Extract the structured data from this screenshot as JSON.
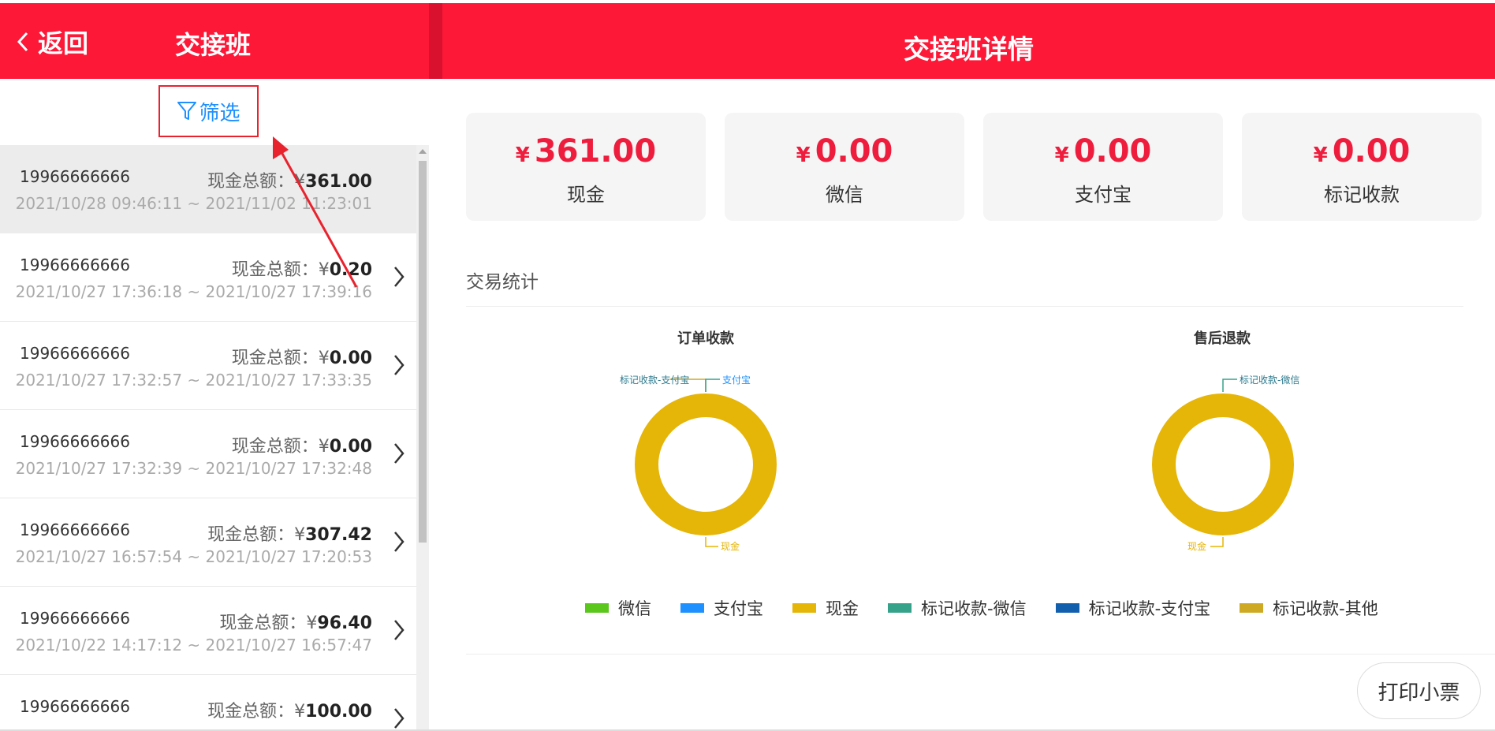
{
  "header": {
    "back_label": "返回",
    "left_title": "交接班",
    "right_title": "交接班详情"
  },
  "filter": {
    "label": "筛选"
  },
  "shift_list": {
    "amount_prefix": "现金总额：¥",
    "rows": [
      {
        "phone": "19966666666",
        "amount": "361.00",
        "time": "2021/10/28 09:46:11 ~ 2021/11/02 11:23:01"
      },
      {
        "phone": "19966666666",
        "amount": "0.20",
        "time": "2021/10/27 17:36:18 ~ 2021/10/27 17:39:16"
      },
      {
        "phone": "19966666666",
        "amount": "0.00",
        "time": "2021/10/27 17:32:57 ~ 2021/10/27 17:33:35"
      },
      {
        "phone": "19966666666",
        "amount": "0.00",
        "time": "2021/10/27 17:32:39 ~ 2021/10/27 17:32:48"
      },
      {
        "phone": "19966666666",
        "amount": "307.42",
        "time": "2021/10/27 16:57:54 ~ 2021/10/27 17:20:53"
      },
      {
        "phone": "19966666666",
        "amount": "96.40",
        "time": "2021/10/22 14:17:12 ~ 2021/10/27 16:57:47"
      },
      {
        "phone": "19966666666",
        "amount": "100.00",
        "time": ""
      }
    ]
  },
  "summary_cards": [
    {
      "currency": "¥",
      "value": "361.00",
      "label": "现金"
    },
    {
      "currency": "¥",
      "value": "0.00",
      "label": "微信"
    },
    {
      "currency": "¥",
      "value": "0.00",
      "label": "支付宝"
    },
    {
      "currency": "¥",
      "value": "0.00",
      "label": "标记收款"
    }
  ],
  "stats": {
    "section_title": "交易统计"
  },
  "colors": {
    "header_red": "#fd1838",
    "amount_red": "#ee1d3d",
    "wechat": "#5bc61c",
    "alipay": "#1e90ff",
    "cash": "#e5b507",
    "mark_wechat": "#36a28a",
    "mark_alipay": "#115fad",
    "mark_other": "#cea923"
  },
  "chart_data": [
    {
      "type": "pie",
      "title": "订单收款",
      "categories": [
        "微信",
        "支付宝",
        "现金",
        "标记收款-微信",
        "标记收款-支付宝",
        "标记收款-其他"
      ],
      "values": [
        0,
        0,
        361.0,
        0,
        0,
        0
      ],
      "labels_shown": {
        "top_left": "标记收款-支付宝",
        "top_right": "支付宝",
        "bottom": "现金"
      }
    },
    {
      "type": "pie",
      "title": "售后退款",
      "categories": [
        "微信",
        "支付宝",
        "现金",
        "标记收款-微信",
        "标记收款-支付宝",
        "标记收款-其他"
      ],
      "values": [
        0,
        0,
        1,
        0,
        0,
        0
      ],
      "labels_shown": {
        "top_right": "标记收款-微信",
        "bottom": "现金"
      }
    }
  ],
  "legend": [
    {
      "label": "微信",
      "color": "#5bc61c"
    },
    {
      "label": "支付宝",
      "color": "#1e90ff"
    },
    {
      "label": "现金",
      "color": "#e5b507"
    },
    {
      "label": "标记收款-微信",
      "color": "#36a28a"
    },
    {
      "label": "标记收款-支付宝",
      "color": "#115fad"
    },
    {
      "label": "标记收款-其他",
      "color": "#cea923"
    }
  ],
  "print": {
    "label": "打印小票"
  }
}
